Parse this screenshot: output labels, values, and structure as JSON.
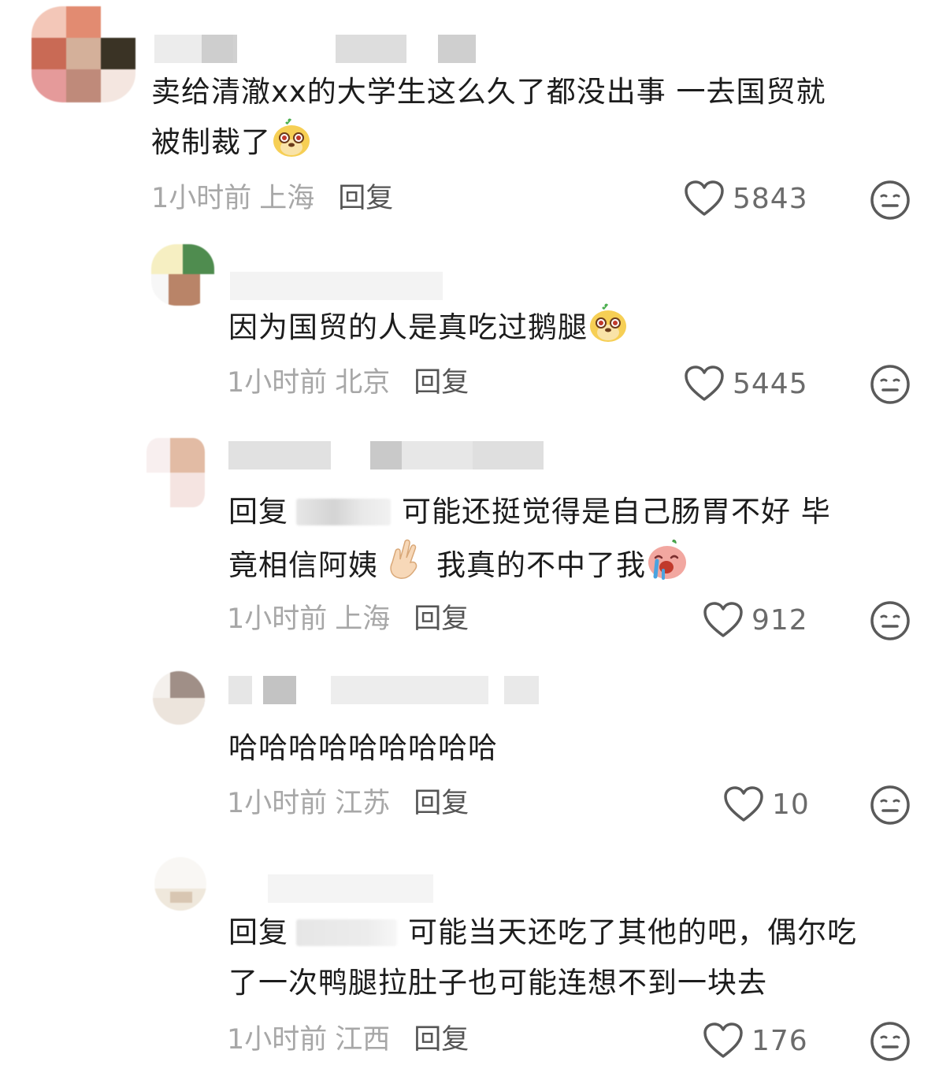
{
  "comments": [
    {
      "text_lines": [
        "卖给清澈xx的大学生这么久了都没出事 一去国贸就",
        "被制裁了"
      ],
      "time": "1小时前",
      "location": "上海",
      "reply_label": "回复",
      "likes": "5843",
      "emoji": "dog-face-emoji"
    },
    {
      "text_lines": [
        "因为国贸的人是真吃过鹅腿"
      ],
      "time": "1小时前",
      "location": "北京",
      "reply_label": "回复",
      "likes": "5445",
      "emoji": "dog-face-emoji"
    },
    {
      "prefix": "回复",
      "text_lines": [
        "可能还挺觉得是自己肠胃不好 毕",
        "竟相信阿姨",
        "我真的不中了我"
      ],
      "time": "1小时前",
      "location": "上海",
      "reply_label": "回复",
      "likes": "912",
      "emoji": "crying-face-emoji",
      "hand_emoji": "crossed-fingers-emoji"
    },
    {
      "text_lines": [
        "哈哈哈哈哈哈哈哈哈"
      ],
      "time": "1小时前",
      "location": "江苏",
      "reply_label": "回复",
      "likes": "10"
    },
    {
      "prefix": "回复",
      "text_lines": [
        "可能当天还吃了其他的吧，偶尔吃",
        "了一次鸭腿拉肚子也可能连想不到一块去"
      ],
      "time": "1小时前",
      "location": "江西",
      "reply_label": "回复",
      "likes": "176"
    }
  ],
  "colors": {
    "text": "#1c1c1c",
    "meta": "#a7a7a7",
    "icon": "#5a5a5a"
  }
}
